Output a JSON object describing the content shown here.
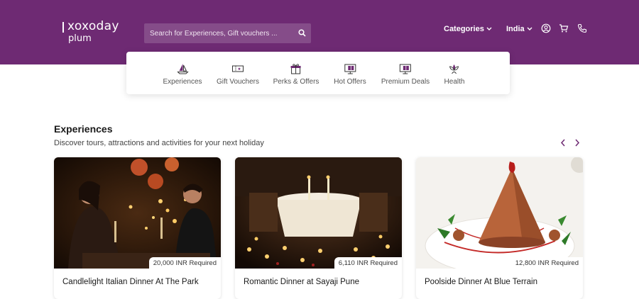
{
  "brand": {
    "name": "xoxoday",
    "sub": "plum",
    "color": "#6e2a73"
  },
  "search": {
    "placeholder": "Search for Experiences, Gift vouchers ..."
  },
  "nav": {
    "categories": "Categories",
    "country": "India",
    "icons": [
      "user-icon",
      "cart-icon",
      "phone-icon"
    ]
  },
  "category_bar": [
    {
      "label": "Experiences",
      "icon": "sailboat-icon"
    },
    {
      "label": "Gift Vouchers",
      "icon": "ticket-icon"
    },
    {
      "label": "Perks & Offers",
      "icon": "gift-icon"
    },
    {
      "label": "Hot Offers",
      "icon": "monitor-gift-icon"
    },
    {
      "label": "Premium Deals",
      "icon": "monitor-gift-icon"
    },
    {
      "label": "Health",
      "icon": "lotus-icon"
    }
  ],
  "section": {
    "title": "Experiences",
    "subtitle": "Discover tours, attractions and activities for your next holiday"
  },
  "cards": [
    {
      "title": "Candlelight Italian Dinner At The Park",
      "points": "20,000 INR Required"
    },
    {
      "title": "Romantic Dinner at Sayaji Pune",
      "points": "6,110 INR Required"
    },
    {
      "title": "Poolside Dinner At Blue Terrain",
      "points": "12,800 INR Required"
    }
  ]
}
